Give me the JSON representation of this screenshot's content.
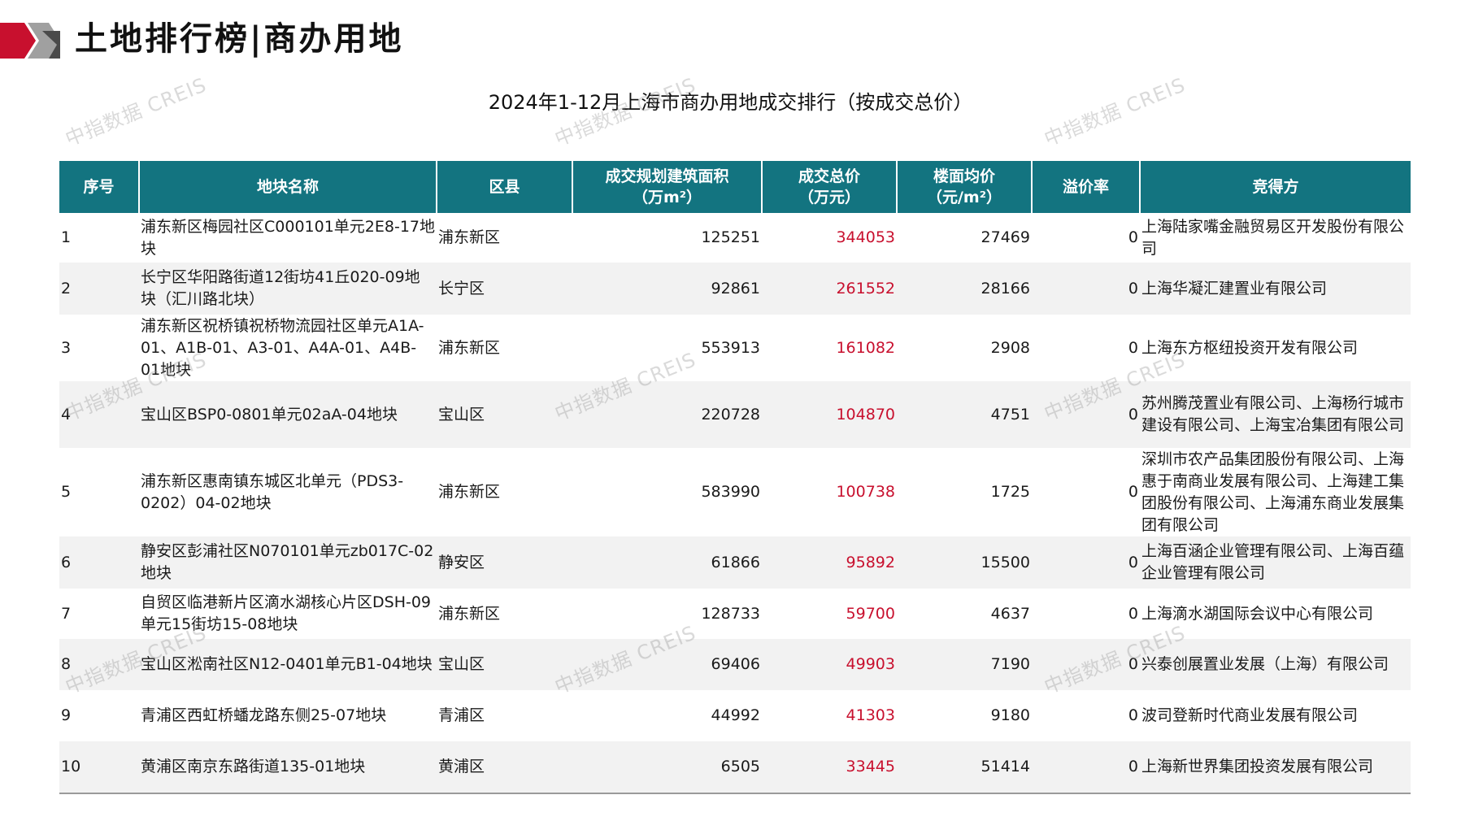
{
  "header": {
    "title": "土地排行榜|商办用地"
  },
  "watermark_text": "中指数据 CREIS",
  "table": {
    "title": "2024年1-12月上海市商办用地成交排行（按成交总价）",
    "columns": [
      "序号",
      "地块名称",
      "区县",
      "成交规划建筑面积\n（万m²）",
      "成交总价\n（万元）",
      "楼面均价\n（元/m²）",
      "溢价率",
      "竞得方"
    ],
    "rows": [
      {
        "idx": "1",
        "name": "浦东新区梅园社区C000101单元2E8-17地块",
        "district": "浦东新区",
        "area": "125251",
        "total": "344053",
        "unit": "27469",
        "premium": "0",
        "winner": "上海陆家嘴金融贸易区开发股份有限公司"
      },
      {
        "idx": "2",
        "name": "长宁区华阳路街道12街坊41丘020-09地块（汇川路北块）",
        "district": "长宁区",
        "area": "92861",
        "total": "261552",
        "unit": "28166",
        "premium": "0",
        "winner": "上海华凝汇建置业有限公司"
      },
      {
        "idx": "3",
        "name": "浦东新区祝桥镇祝桥物流园社区单元A1A-01、A1B-01、A3-01、A4A-01、A4B-01地块",
        "district": "浦东新区",
        "area": "553913",
        "total": "161082",
        "unit": "2908",
        "premium": "0",
        "winner": "上海东方枢纽投资开发有限公司"
      },
      {
        "idx": "4",
        "name": "宝山区BSP0-0801单元02aA-04地块",
        "district": "宝山区",
        "area": "220728",
        "total": "104870",
        "unit": "4751",
        "premium": "0",
        "winner": "苏州腾茂置业有限公司、上海杨行城市建设有限公司、上海宝冶集团有限公司"
      },
      {
        "idx": "5",
        "name": "浦东新区惠南镇东城区北单元（PDS3-0202）04-02地块",
        "district": "浦东新区",
        "area": "583990",
        "total": "100738",
        "unit": "1725",
        "premium": "0",
        "winner": "深圳市农产品集团股份有限公司、上海惠于南商业发展有限公司、上海建工集团股份有限公司、上海浦东商业发展集团有限公司"
      },
      {
        "idx": "6",
        "name": "静安区彭浦社区N070101单元zb017C-02地块",
        "district": "静安区",
        "area": "61866",
        "total": "95892",
        "unit": "15500",
        "premium": "0",
        "winner": "上海百涵企业管理有限公司、上海百蕴企业管理有限公司"
      },
      {
        "idx": "7",
        "name": "自贸区临港新片区滴水湖核心片区DSH-09单元15街坊15-08地块",
        "district": "浦东新区",
        "area": "128733",
        "total": "59700",
        "unit": "4637",
        "premium": "0",
        "winner": "上海滴水湖国际会议中心有限公司"
      },
      {
        "idx": "8",
        "name": "宝山区淞南社区N12-0401单元B1-04地块",
        "district": "宝山区",
        "area": "69406",
        "total": "49903",
        "unit": "7190",
        "premium": "0",
        "winner": "兴泰创展置业发展（上海）有限公司"
      },
      {
        "idx": "9",
        "name": "青浦区西虹桥蟠龙路东侧25-07地块",
        "district": "青浦区",
        "area": "44992",
        "total": "41303",
        "unit": "9180",
        "premium": "0",
        "winner": "波司登新时代商业发展有限公司"
      },
      {
        "idx": "10",
        "name": "黄浦区南京东路街道135-01地块",
        "district": "黄浦区",
        "area": "6505",
        "total": "33445",
        "unit": "51414",
        "premium": "0",
        "winner": "上海新世界集团投资发展有限公司"
      }
    ]
  }
}
